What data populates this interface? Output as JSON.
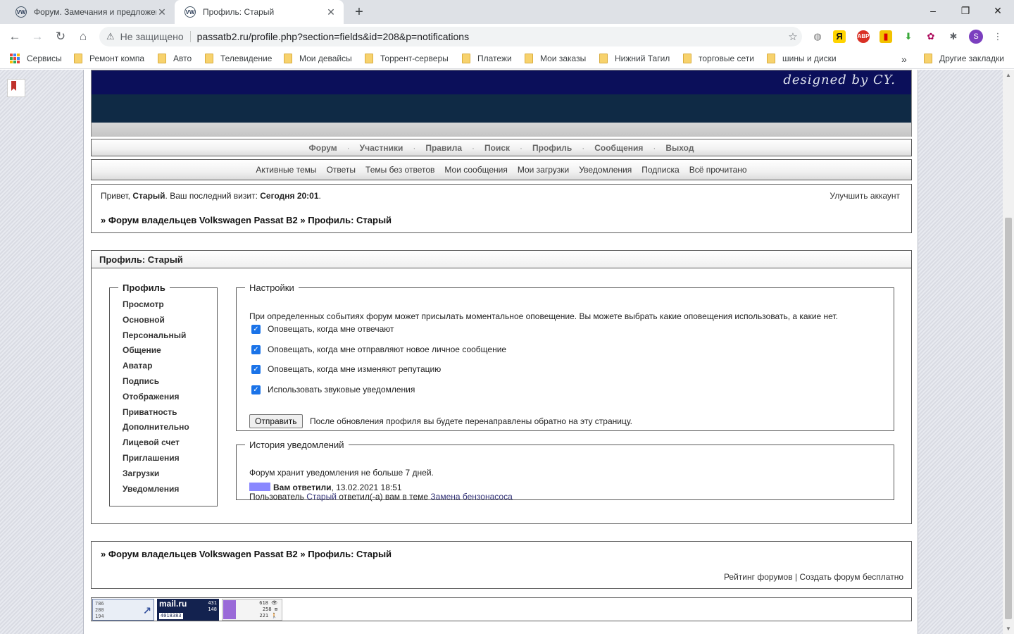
{
  "browser": {
    "tabs": [
      {
        "title": "Форум. Замечания и предложения",
        "favicon": "vw-logo"
      },
      {
        "title": "Профиль: Старый",
        "favicon": "vw-logo"
      }
    ],
    "new_tab": "+",
    "window_controls": {
      "minimize": "–",
      "restore": "❐",
      "close": "✕"
    },
    "address": {
      "security": "Не защищено",
      "url": "passatb2.ru/profile.php?section=fields&id=208&p=notifications"
    },
    "profile_initial": "S",
    "bookmarks": [
      "Сервисы",
      "Ремонт компа",
      "Авто",
      "Телевидение",
      "Мои девайсы",
      "Торрент-серверы",
      "Платежи",
      "Мои заказы",
      "Нижний Тагил",
      "торговые сети",
      "шины и диски"
    ],
    "bookmarks_overflow": "»",
    "other_bookmarks": "Другие закладки"
  },
  "banner": {
    "signature": "designed by CY."
  },
  "main_nav": [
    "Форум",
    "Участники",
    "Правила",
    "Поиск",
    "Профиль",
    "Сообщения",
    "Выход"
  ],
  "sub_nav": [
    "Активные темы",
    "Ответы",
    "Темы без ответов",
    "Мои сообщения",
    "Мои загрузки",
    "Уведомления",
    "Подписка",
    "Всё прочитано"
  ],
  "welcome": {
    "greeting": "Привет,",
    "username": "Старый",
    "last_visit_label": ". Ваш последний визит:",
    "last_visit_value": "Сегодня 20:01",
    "period": ".",
    "upgrade": "Улучшить аккаунт"
  },
  "breadcrumb": {
    "prefix": "»",
    "forum": "Форум владельцев Volkswagen Passat B2",
    "sep": "»",
    "current": "Профиль: Старый"
  },
  "profile_header": "Профиль: Старый",
  "profile_menu": {
    "legend": "Профиль",
    "items": [
      "Просмотр",
      "Основной",
      "Персональный",
      "Общение",
      "Аватар",
      "Подпись",
      "Отображения",
      "Приватность",
      "Дополнительно",
      "Лицевой счет",
      "Приглашения",
      "Загрузки",
      "Уведомления"
    ]
  },
  "settings": {
    "legend": "Настройки",
    "intro": "При определенных событиях форум может присылать моментальное оповещение. Вы можете выбрать какие оповещения использовать, а какие нет.",
    "options": [
      {
        "label": "Оповещать, когда мне отвечают",
        "checked": true
      },
      {
        "label": "Оповещать, когда мне отправляют новое личное сообщение",
        "checked": true
      },
      {
        "label": "Оповещать, когда мне изменяют репутацию",
        "checked": true
      },
      {
        "label": "Использовать звуковые уведомления",
        "checked": true
      }
    ],
    "submit": "Отправить",
    "hint": "После обновления профиля вы будете перенаправлены обратно на эту страницу."
  },
  "history": {
    "legend": "История уведомлений",
    "note": "Форум хранит уведомления не больше 7 дней.",
    "entry_title": "Вам ответили",
    "entry_date": ", 13.02.2021 18:51",
    "detail_prefix": "Пользователь",
    "detail_user": "Старый",
    "detail_mid": "ответил(-а) вам в теме",
    "detail_topic": "Замена бензонасоса",
    "swatch_color": "#8a88ff"
  },
  "footer": {
    "rating": "Рейтинг форумов",
    "sep": "|",
    "create": "Создать форум бесплатно"
  },
  "counters": {
    "c1": [
      "786",
      "280",
      "194"
    ],
    "c2": {
      "logo": "mail.ru",
      "nums": [
        "431",
        "148"
      ],
      "total": "4018383"
    },
    "c3": [
      "618 👁",
      "258 ⊞",
      "221 🚶"
    ]
  }
}
